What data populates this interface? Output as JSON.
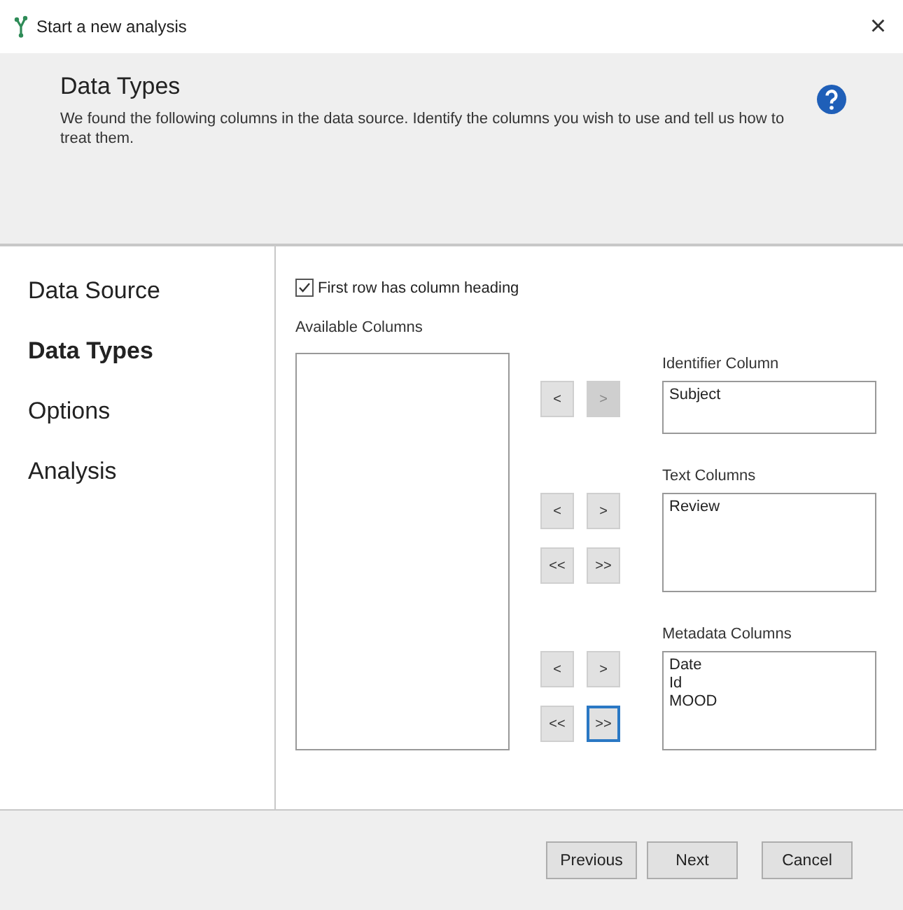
{
  "window": {
    "title": "Start a new analysis",
    "close": "×"
  },
  "header": {
    "title": "Data Types",
    "description": "We found the following columns in the data source. Identify the columns you wish to use and tell us how to treat them."
  },
  "steps": [
    {
      "label": "Data Source",
      "selected": false
    },
    {
      "label": "Data Types",
      "selected": true
    },
    {
      "label": "Options",
      "selected": false
    },
    {
      "label": "Analysis",
      "selected": false
    }
  ],
  "first_row_heading": {
    "label": "First row has column heading",
    "checked": true
  },
  "available": {
    "label": "Available Columns"
  },
  "targets": [
    {
      "label": "Identifier Column",
      "items": [
        "Subject"
      ],
      "buttons": [
        {
          "label": "<",
          "disabled": false,
          "focused": false
        },
        {
          "label": ">",
          "disabled": true,
          "focused": false
        }
      ]
    },
    {
      "label": "Text Columns",
      "items": [
        "Review"
      ],
      "buttons": [
        {
          "label": "<",
          "disabled": false,
          "focused": false
        },
        {
          "label": ">",
          "disabled": false,
          "focused": false
        },
        {
          "label": "<<",
          "disabled": false,
          "focused": false
        },
        {
          "label": ">>",
          "disabled": false,
          "focused": false
        }
      ]
    },
    {
      "label": "Metadata Columns",
      "items": [
        "Date",
        "Id",
        "MOOD"
      ],
      "buttons": [
        {
          "label": "<",
          "disabled": false,
          "focused": false
        },
        {
          "label": ">",
          "disabled": false,
          "focused": false
        },
        {
          "label": "<<",
          "disabled": false,
          "focused": false
        },
        {
          "label": ">>",
          "disabled": false,
          "focused": true
        }
      ]
    }
  ],
  "footer": {
    "buttons": [
      "Previous",
      "Next",
      "Cancel"
    ]
  }
}
